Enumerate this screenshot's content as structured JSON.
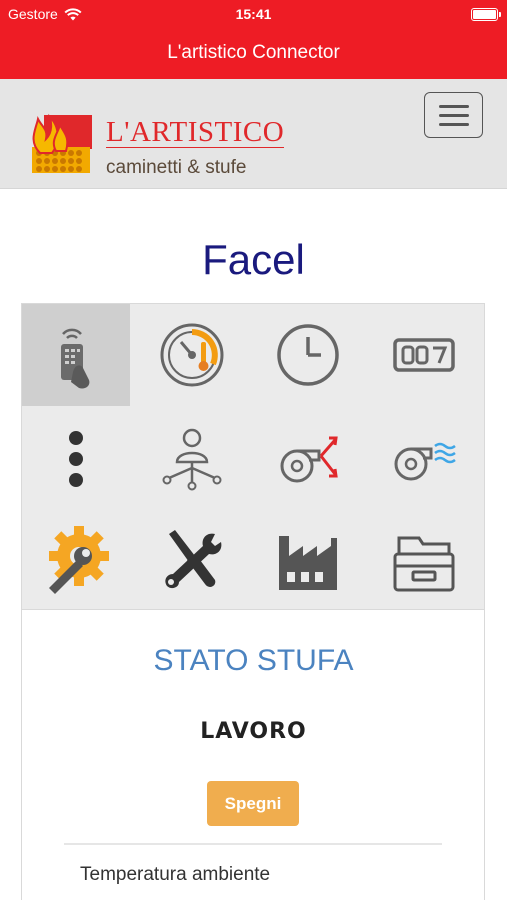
{
  "status_bar": {
    "carrier": "Gestore",
    "time": "15:41"
  },
  "nav_bar": {
    "title": "L'artistico Connector"
  },
  "header": {
    "logo": {
      "brand": "L'ARTISTICO",
      "tagline": "caminetti & stufe"
    },
    "menu_icon": "hamburger-menu-icon"
  },
  "device": {
    "name": "Facel"
  },
  "toolbar": {
    "items": [
      {
        "icon": "remote-control-icon",
        "active": true
      },
      {
        "icon": "thermostat-dial-icon",
        "active": false
      },
      {
        "icon": "clock-icon",
        "active": false
      },
      {
        "icon": "display-counter-icon",
        "active": false
      },
      {
        "icon": "more-options-icon",
        "active": false
      },
      {
        "icon": "user-network-icon",
        "active": false
      },
      {
        "icon": "fan-split-icon",
        "active": false
      },
      {
        "icon": "fan-air-icon",
        "active": false
      },
      {
        "icon": "gear-wrench-icon",
        "active": false
      },
      {
        "icon": "tools-icon",
        "active": false
      },
      {
        "icon": "factory-icon",
        "active": false
      },
      {
        "icon": "archive-icon",
        "active": false
      }
    ]
  },
  "stove_status": {
    "title": "STATO STUFA",
    "state": "LAVORO",
    "off_button": "Spegni",
    "ambient_temperature_label": "Temperatura ambiente"
  },
  "colors": {
    "accent_red": "#ee1c25",
    "title_blue": "#1a1a7e",
    "status_blue": "#4b83c0",
    "button_orange": "#f0ad4e"
  }
}
